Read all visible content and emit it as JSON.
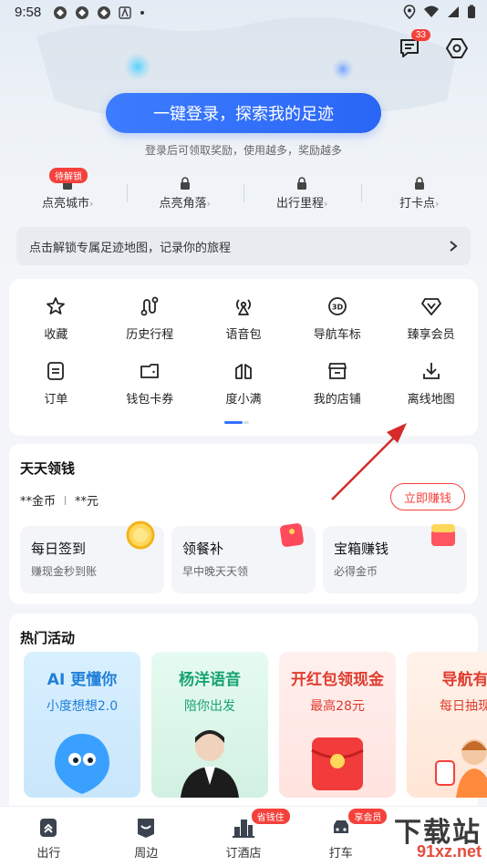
{
  "status_bar": {
    "time": "9:58"
  },
  "header": {
    "message_badge": "33"
  },
  "login": {
    "button_label": "一键登录，探索我的足迹",
    "hint": "登录后可领取奖励，使用越多，奖励越多"
  },
  "stats": [
    {
      "label": "点亮城市",
      "tag": "待解锁"
    },
    {
      "label": "点亮角落"
    },
    {
      "label": "出行里程"
    },
    {
      "label": "打卡点"
    }
  ],
  "unlock_banner": {
    "text": "点击解锁专属足迹地图，记录你的旅程"
  },
  "grid": {
    "items": [
      {
        "label": "收藏",
        "icon": "star-icon"
      },
      {
        "label": "历史行程",
        "icon": "route-icon"
      },
      {
        "label": "语音包",
        "icon": "voice-icon"
      },
      {
        "label": "导航车标",
        "icon": "3d-icon"
      },
      {
        "label": "臻享会员",
        "icon": "diamond-icon"
      },
      {
        "label": "订单",
        "icon": "order-icon"
      },
      {
        "label": "钱包卡券",
        "icon": "wallet-icon"
      },
      {
        "label": "度小满",
        "icon": "duxiaoman-icon"
      },
      {
        "label": "我的店铺",
        "icon": "store-icon"
      },
      {
        "label": "离线地图",
        "icon": "download-icon"
      }
    ]
  },
  "money": {
    "title": "天天领钱",
    "coins": "**金币",
    "cash": "**元",
    "earn_button": "立即赚钱",
    "tasks": [
      {
        "title": "每日签到",
        "sub": "赚现金秒到账"
      },
      {
        "title": "领餐补",
        "sub": "早中晚天天领"
      },
      {
        "title": "宝箱赚钱",
        "sub": "必得金币"
      }
    ]
  },
  "hot": {
    "title": "热门活动",
    "promos": [
      {
        "title": "AI 更懂你",
        "sub": "小度想想2.0"
      },
      {
        "title": "杨洋语音",
        "sub": "陪你出发"
      },
      {
        "title": "开红包领现金",
        "sub": "最高28元"
      },
      {
        "title": "导航有",
        "sub": "每日抽现"
      }
    ]
  },
  "tabbar": [
    {
      "label": "出行"
    },
    {
      "label": "周边"
    },
    {
      "label": "订酒店",
      "tag": "省钱住"
    },
    {
      "label": "打车",
      "tag": "享会员"
    }
  ],
  "watermark": {
    "line1": "下载站",
    "line2": "91xz.net"
  },
  "colors": {
    "accent": "#3370ff",
    "red": "#f5413c"
  }
}
